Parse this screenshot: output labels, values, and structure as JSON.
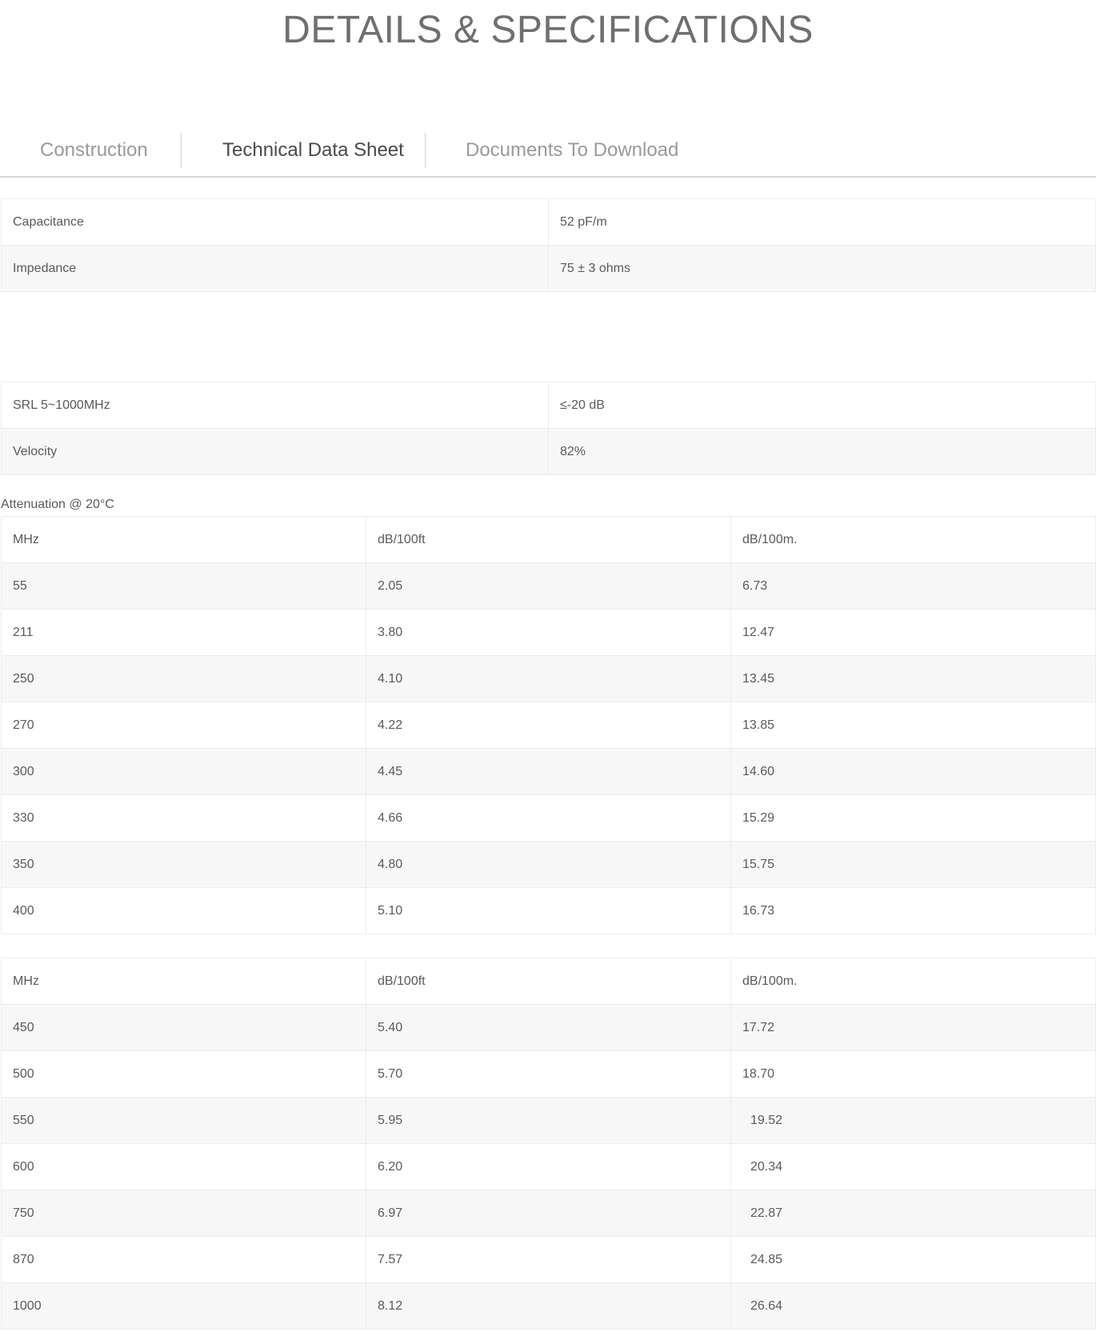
{
  "page_title": "DETAILS & SPECIFICATIONS",
  "tabs": [
    {
      "label": "Construction",
      "active": false
    },
    {
      "label": "Technical Data Sheet",
      "active": true
    },
    {
      "label": "Documents To Download",
      "active": false
    }
  ],
  "electrical_1": [
    {
      "label": "Capacitance",
      "value": "52 pF/m"
    },
    {
      "label": "Impedance",
      "value": "75 ± 3 ohms"
    }
  ],
  "electrical_2": [
    {
      "label": "SRL 5~1000MHz",
      "value": "≤-20 dB"
    },
    {
      "label": "Velocity",
      "value": "82%"
    }
  ],
  "attenuation_label": "Attenuation @ 20°C",
  "attenuation_table_1": {
    "headers": [
      "MHz",
      "dB/100ft",
      "dB/100m."
    ],
    "rows": [
      [
        "55",
        "2.05",
        "6.73"
      ],
      [
        "211",
        "3.80",
        "12.47"
      ],
      [
        "250",
        "4.10",
        "13.45"
      ],
      [
        "270",
        "4.22",
        "13.85"
      ],
      [
        "300",
        "4.45",
        "14.60"
      ],
      [
        "330",
        "4.66",
        "15.29"
      ],
      [
        "350",
        "4.80",
        "15.75"
      ],
      [
        "400",
        "5.10",
        "16.73"
      ]
    ]
  },
  "attenuation_table_2": {
    "headers": [
      "MHz",
      "dB/100ft",
      "dB/100m."
    ],
    "rows": [
      [
        "450",
        "5.40",
        "17.72"
      ],
      [
        "500",
        "5.70",
        "18.70"
      ],
      [
        "550",
        "5.95",
        "19.52"
      ],
      [
        "600",
        "6.20",
        "20.34"
      ],
      [
        "750",
        "6.97",
        "22.87"
      ],
      [
        "870",
        "7.57",
        "24.85"
      ],
      [
        "1000",
        "8.12",
        "26.64"
      ]
    ]
  }
}
